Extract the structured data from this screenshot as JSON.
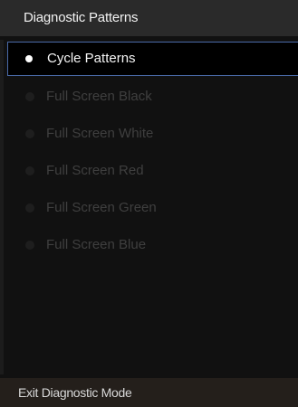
{
  "panel": {
    "title": "Diagnostic Patterns"
  },
  "menu": {
    "items": [
      {
        "label": "Cycle Patterns",
        "selected": true
      },
      {
        "label": "Full Screen Black",
        "selected": false
      },
      {
        "label": "Full Screen White",
        "selected": false
      },
      {
        "label": "Full Screen Red",
        "selected": false
      },
      {
        "label": "Full Screen Green",
        "selected": false
      },
      {
        "label": "Full Screen Blue",
        "selected": false
      }
    ]
  },
  "footer": {
    "exit_label": "Exit Diagnostic Mode"
  },
  "colors": {
    "selection_border": "#4a6aa8",
    "selected_text": "#f5f5f5",
    "dimmed_text": "#3f3f3f",
    "footer_background": "#241f1b"
  }
}
